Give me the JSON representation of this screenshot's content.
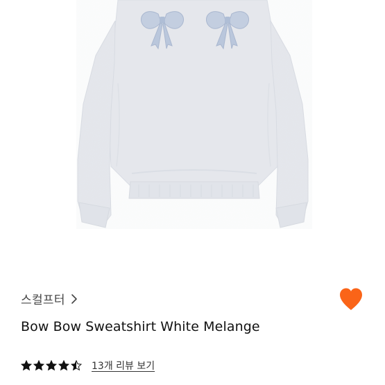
{
  "product": {
    "image_alt": "Bow Bow Sweatshirt White Melange",
    "brand": "스컬프터",
    "title": "Bow Bow Sweatshirt White Melange",
    "rating": 4.5,
    "rating_max": 5,
    "review_link": "13개 리뷰 보기",
    "wishlisted": true
  },
  "colors": {
    "heart": "#FA6418",
    "star": "#111111",
    "sweatshirt": "#E6E8ED",
    "bow": "#B9C6DC"
  },
  "icons": {
    "brand_chevron": "chevron-right-icon",
    "wishlist": "heart-icon",
    "rating": "star-icon"
  }
}
